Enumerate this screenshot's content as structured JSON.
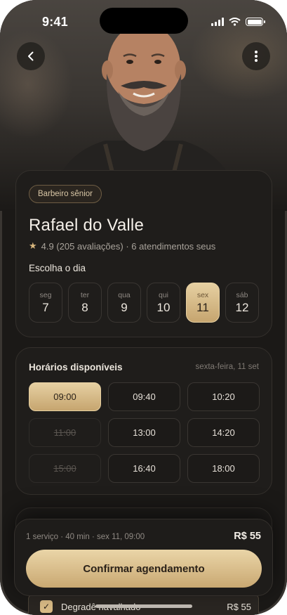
{
  "status_bar": {
    "time": "9:41"
  },
  "colors": {
    "accent_gold": "#d9bb86",
    "background": "#1b1917",
    "card": "#1f1d1b"
  },
  "header": {
    "back_icon": "chevron-left-icon",
    "more_icon": "more-vertical-icon"
  },
  "profile": {
    "badge": "Barbeiro sênior",
    "name": "Rafael do Valle",
    "rating": "4.9 (205 avaliações) · 6 atendimentos seus",
    "choose_day_label": "Escolha o dia",
    "days": [
      {
        "weekday": "seg",
        "day": "7",
        "selected": false
      },
      {
        "weekday": "ter",
        "day": "8",
        "selected": false
      },
      {
        "weekday": "qua",
        "day": "9",
        "selected": false
      },
      {
        "weekday": "qui",
        "day": "10",
        "selected": false
      },
      {
        "weekday": "sex",
        "day": "11",
        "selected": true
      },
      {
        "weekday": "sáb",
        "day": "12",
        "selected": false
      }
    ]
  },
  "times": {
    "title": "Horários disponíveis",
    "date": "sexta-feira, 11 set",
    "slots": [
      {
        "time": "09:00",
        "state": "selected"
      },
      {
        "time": "09:40",
        "state": "available"
      },
      {
        "time": "10:20",
        "state": "available"
      },
      {
        "time": "11:00",
        "state": "unavailable"
      },
      {
        "time": "13:00",
        "state": "available"
      },
      {
        "time": "14:20",
        "state": "available"
      },
      {
        "time": "15:00",
        "state": "unavailable"
      },
      {
        "time": "16:40",
        "state": "available"
      },
      {
        "time": "18:00",
        "state": "available"
      }
    ]
  },
  "services": {
    "items": [
      {
        "name": "Degradê navalhado",
        "price": "R$ 55",
        "checked": true
      }
    ]
  },
  "booking": {
    "summary": "1 serviço · 40 min · sex 11, 09:00",
    "total": "R$ 55",
    "confirm_label": "Confirmar agendamento"
  }
}
